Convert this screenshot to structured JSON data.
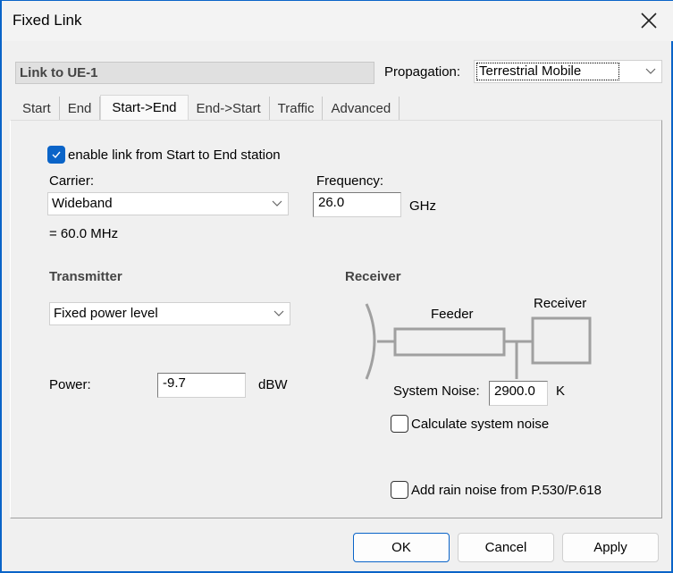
{
  "window": {
    "title": "Fixed Link"
  },
  "header": {
    "link_name": "Link to UE-1",
    "propagation_label": "Propagation:",
    "propagation_value": "Terrestrial Mobile"
  },
  "tabs": [
    {
      "label": "Start",
      "active": false
    },
    {
      "label": "End",
      "active": false
    },
    {
      "label": "Start->End",
      "active": true
    },
    {
      "label": "End->Start",
      "active": false
    },
    {
      "label": "Traffic",
      "active": false
    },
    {
      "label": "Advanced",
      "active": false
    }
  ],
  "panel": {
    "enable_link": {
      "label": "enable link from Start to End station",
      "checked": true
    },
    "carrier": {
      "label": "Carrier:",
      "value": "Wideband",
      "bandwidth": "= 60.0 MHz"
    },
    "frequency": {
      "label": "Frequency:",
      "value": "26.0",
      "unit": "GHz"
    },
    "transmitter": {
      "heading": "Transmitter",
      "mode": "Fixed power level",
      "power_label": "Power:",
      "power_value": "-9.7",
      "power_unit": "dBW"
    },
    "receiver": {
      "heading": "Receiver",
      "diagram": {
        "feeder_label": "Feeder",
        "receiver_label": "Receiver"
      },
      "system_noise_label": "System Noise:",
      "system_noise_value": "2900.0",
      "system_noise_unit": "K",
      "calculate_noise": {
        "label": "Calculate system noise",
        "checked": false
      },
      "rain_noise": {
        "label": "Add rain noise from P.530/P.618",
        "checked": false
      }
    }
  },
  "buttons": {
    "ok": "OK",
    "cancel": "Cancel",
    "apply": "Apply"
  },
  "colors": {
    "accent": "#0a64c8",
    "diagram": "#a0a0a0"
  }
}
